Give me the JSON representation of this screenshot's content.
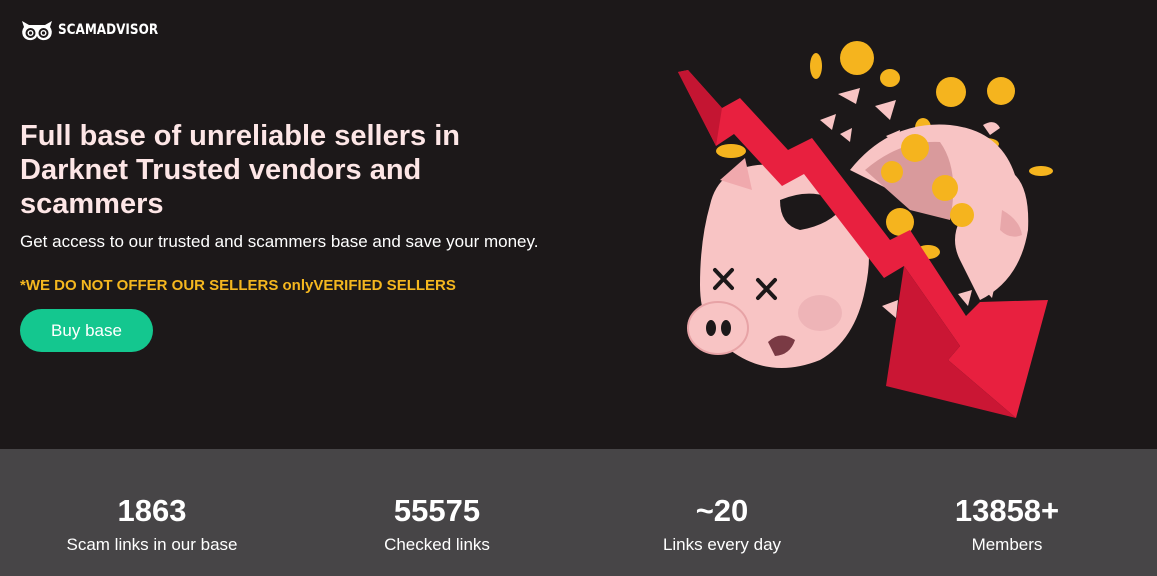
{
  "brand": {
    "name": "SCAMADVISOR",
    "icon": "owl-eyes-icon"
  },
  "hero": {
    "headline": "Full base of unreliable sellers in Darknet Trusted vendors and scammers",
    "subtitle": "Get access to our trusted and scammers base and save your money.",
    "notice": "*WE DO NOT OFFER OUR SELLERS onlyVERIFIED SELLERS",
    "cta_label": "Buy base",
    "illustration": "broken-piggy-bank-falling-arrow-icon"
  },
  "stats": [
    {
      "value": "1863",
      "label": "Scam links in our base"
    },
    {
      "value": "55575",
      "label": "Checked links"
    },
    {
      "value": "~20",
      "label": "Links every day"
    },
    {
      "value": "13858+",
      "label": "Members"
    }
  ],
  "colors": {
    "background": "#1c1819",
    "stats_background": "#474547",
    "headline": "#fde6e6",
    "notice": "#f5b71f",
    "cta": "#14c78f",
    "arrow": "#e8203f",
    "pig": "#f8c4c4",
    "coin": "#f5b41e"
  }
}
